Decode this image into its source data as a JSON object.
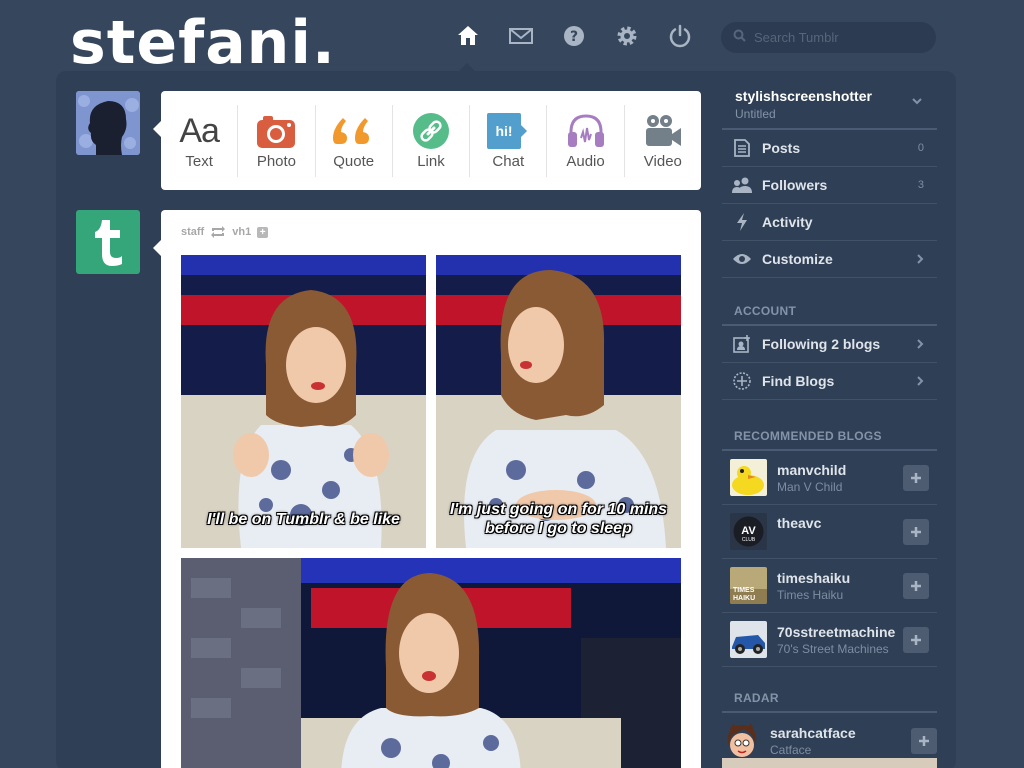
{
  "header": {
    "logo": "stefani.",
    "nav_icons": [
      "home-icon",
      "mail-icon",
      "help-icon",
      "gear-icon",
      "power-icon"
    ],
    "search_placeholder": "Search Tumblr"
  },
  "post_types": [
    {
      "label": "Text",
      "icon": "text-icon",
      "glyph": "Aa",
      "color": "#444444"
    },
    {
      "label": "Photo",
      "icon": "camera-icon",
      "color": "#d95e40"
    },
    {
      "label": "Quote",
      "icon": "quote-icon",
      "glyph": "““",
      "color": "#f2992e"
    },
    {
      "label": "Link",
      "icon": "link-icon",
      "color": "#56bc8a"
    },
    {
      "label": "Chat",
      "icon": "chat-icon",
      "glyph": "hi!",
      "color": "#529ecc"
    },
    {
      "label": "Audio",
      "icon": "headphones-icon",
      "color": "#a77dc2"
    },
    {
      "label": "Video",
      "icon": "video-camera-icon",
      "color": "#748089"
    }
  ],
  "post": {
    "author": "staff",
    "reblogged_from": "vh1",
    "captions": [
      "I'll be on Tumblr & be like",
      "I'm just going on for 10 mins before I go to sleep"
    ]
  },
  "sidebar": {
    "blog": {
      "name": "stylishscreenshotter",
      "title": "Untitled"
    },
    "items": [
      {
        "label": "Posts",
        "icon": "posts-icon",
        "count": "0"
      },
      {
        "label": "Followers",
        "icon": "followers-icon",
        "count": "3"
      },
      {
        "label": "Activity",
        "icon": "lightning-icon"
      },
      {
        "label": "Customize",
        "icon": "eye-icon",
        "arrow": true
      }
    ],
    "account_heading": "ACCOUNT",
    "account_items": [
      {
        "label": "Following 2 blogs",
        "icon": "following-icon"
      },
      {
        "label": "Find Blogs",
        "icon": "compass-icon"
      }
    ],
    "recommended_heading": "RECOMMENDED BLOGS",
    "recommended": [
      {
        "name": "manvchild",
        "title": "Man V Child"
      },
      {
        "name": "theavc",
        "title": ""
      },
      {
        "name": "timeshaiku",
        "title": "Times Haiku"
      },
      {
        "name": "70sstreetmachine",
        "title": "70's Street Machines"
      }
    ],
    "radar_heading": "RADAR",
    "radar": {
      "name": "sarahcatface",
      "title": "Catface"
    }
  },
  "colors": {
    "background": "#36465d",
    "panel": "#2f3f55",
    "staff_avatar": "#35a57a"
  }
}
